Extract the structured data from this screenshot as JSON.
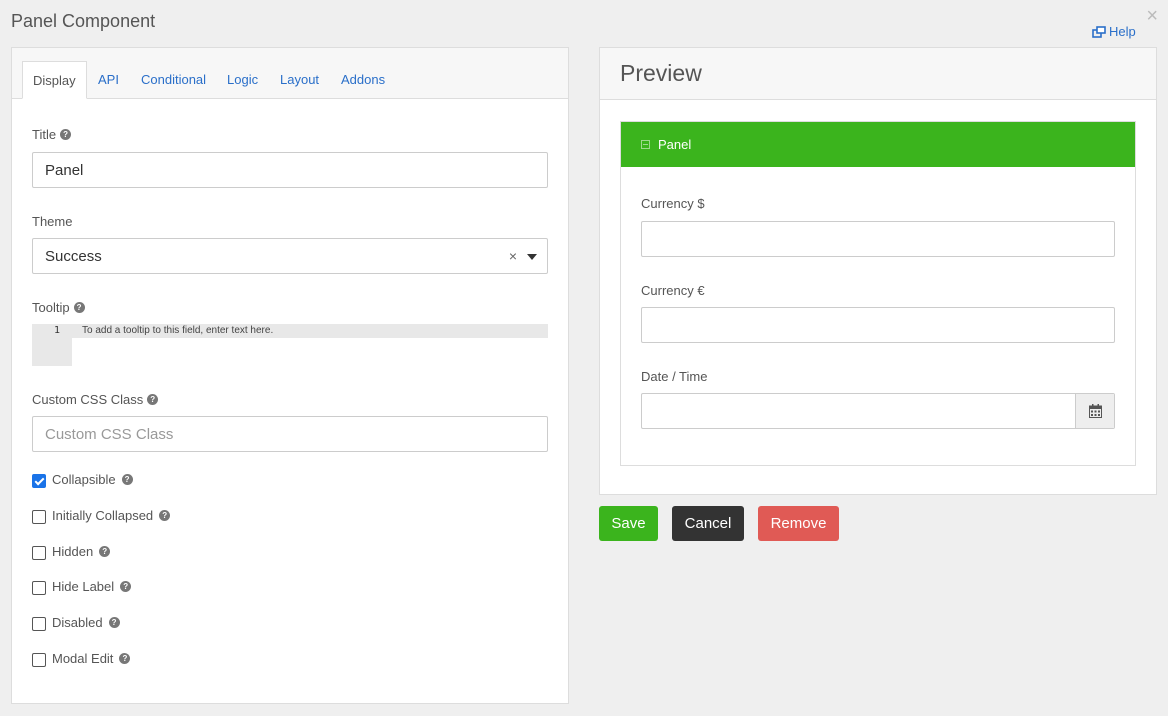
{
  "dialog": {
    "title": "Panel Component",
    "close_icon": "×",
    "help_label": "Help"
  },
  "tabs": [
    {
      "label": "Display"
    },
    {
      "label": "API"
    },
    {
      "label": "Conditional"
    },
    {
      "label": "Logic"
    },
    {
      "label": "Layout"
    },
    {
      "label": "Addons"
    }
  ],
  "form": {
    "title_label": "Title",
    "title_value": "Panel",
    "theme_label": "Theme",
    "theme_value": "Success",
    "theme_clear": "×",
    "tooltip_label": "Tooltip",
    "tooltip_line_number": "1",
    "tooltip_placeholder": "To add a tooltip to this field, enter text here.",
    "css_label": "Custom CSS Class",
    "css_placeholder": "Custom CSS Class",
    "checkboxes": [
      {
        "label": "Collapsible",
        "checked": true
      },
      {
        "label": "Initially Collapsed",
        "checked": false
      },
      {
        "label": "Hidden",
        "checked": false
      },
      {
        "label": "Hide Label",
        "checked": false
      },
      {
        "label": "Disabled",
        "checked": false
      },
      {
        "label": "Modal Edit",
        "checked": false
      }
    ]
  },
  "preview": {
    "heading": "Preview",
    "panel_title": "Panel",
    "panel_color": "#3bb41d",
    "fields": [
      {
        "label": "Currency $"
      },
      {
        "label": "Currency €"
      },
      {
        "label": "Date / Time"
      }
    ]
  },
  "buttons": {
    "save": "Save",
    "cancel": "Cancel",
    "remove": "Remove"
  },
  "colors": {
    "accent": "#2a6fc9",
    "success": "#3bb41d",
    "danger": "#e05a55",
    "dark": "#333333"
  }
}
